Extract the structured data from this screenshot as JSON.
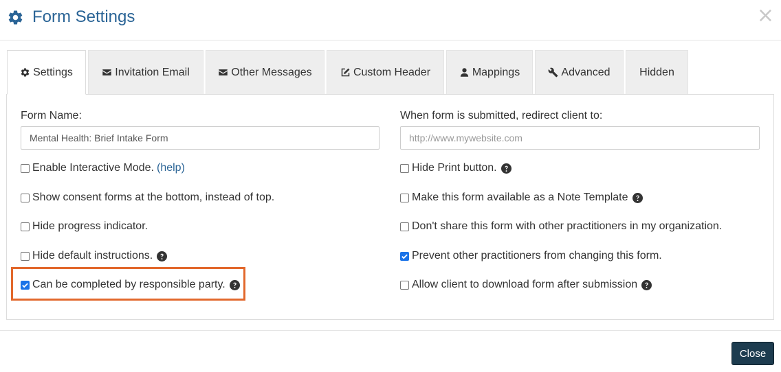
{
  "header": {
    "title": "Form Settings",
    "title_color": "#2a6496",
    "icon": "gear-icon",
    "close_symbol": "×"
  },
  "tabs": [
    {
      "label": "Settings",
      "icon": "gear-icon",
      "active": true
    },
    {
      "label": "Invitation Email",
      "icon": "envelope-icon"
    },
    {
      "label": "Other Messages",
      "icon": "envelope-icon"
    },
    {
      "label": "Custom Header",
      "icon": "edit-icon"
    },
    {
      "label": "Mappings",
      "icon": "user-icon"
    },
    {
      "label": "Advanced",
      "icon": "wrench-icon"
    },
    {
      "label": "Hidden",
      "icon": ""
    }
  ],
  "left": {
    "form_name_label": "Form Name:",
    "form_name_value": "Mental Health: Brief Intake Form",
    "options": [
      {
        "label": "Enable Interactive Mode.",
        "checked": false,
        "help_link": "(help)"
      },
      {
        "label": "Show consent forms at the bottom, instead of top.",
        "checked": false
      },
      {
        "label": "Hide progress indicator.",
        "checked": false
      },
      {
        "label": "Hide default instructions.",
        "checked": false,
        "help_icon": "question-circle-icon"
      },
      {
        "label": "Can be completed by responsible party.",
        "checked": true,
        "help_icon": "question-circle-icon",
        "highlighted": true
      }
    ]
  },
  "right": {
    "redirect_label": "When form is submitted, redirect client to:",
    "redirect_placeholder": "http://www.mywebsite.com",
    "redirect_value": "",
    "options": [
      {
        "label": "Hide Print button.",
        "checked": false,
        "help_icon": "question-circle-icon"
      },
      {
        "label": "Make this form available as a Note Template",
        "checked": false,
        "help_icon": "question-circle-icon"
      },
      {
        "label": "Don't share this form with other practitioners in my organization.",
        "checked": false
      },
      {
        "label": "Prevent other practitioners from changing this form.",
        "checked": true
      },
      {
        "label": "Allow client to download form after submission",
        "checked": false,
        "help_icon": "question-circle-icon"
      }
    ]
  },
  "footer": {
    "close_label": "Close"
  },
  "colors": {
    "accent": "#2a6496",
    "highlight": "#e2682c",
    "checkbox_checked": "#1a73e8",
    "button_bg": "#1d3c4f"
  }
}
